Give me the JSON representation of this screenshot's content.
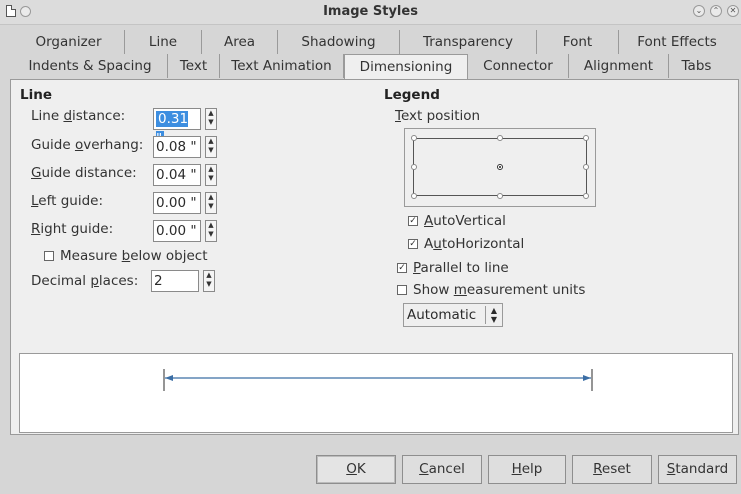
{
  "window": {
    "title": "Image Styles"
  },
  "tabs_row1": [
    "Organizer",
    "Line",
    "Area",
    "Shadowing",
    "Transparency",
    "Font",
    "Font Effects"
  ],
  "tabs_row2": [
    "Indents & Spacing",
    "Text",
    "Text Animation",
    "Dimensioning",
    "Connector",
    "Alignment",
    "Tabs"
  ],
  "active_tab": "Dimensioning",
  "line": {
    "title": "Line",
    "line_distance": {
      "label_pre": "Line ",
      "label_mn": "d",
      "label_post": "istance:",
      "value": "0.31 \""
    },
    "guide_overhang": {
      "label_pre": "Guide ",
      "label_mn": "o",
      "label_post": "verhang:",
      "value": "0.08 \""
    },
    "guide_distance": {
      "label_pre": "",
      "label_mn": "G",
      "label_post": "uide distance:",
      "value": "0.04 \""
    },
    "left_guide": {
      "label_pre": "",
      "label_mn": "L",
      "label_post": "eft guide:",
      "value": "0.00 \""
    },
    "right_guide": {
      "label_pre": "",
      "label_mn": "R",
      "label_post": "ight guide:",
      "value": "0.00 \""
    },
    "measure_below": {
      "label_pre": "Measure ",
      "label_mn": "b",
      "label_post": "elow object",
      "checked": false
    },
    "decimal_places": {
      "label_pre": "Decimal ",
      "label_mn": "p",
      "label_post": "laces:",
      "value": "2"
    }
  },
  "legend": {
    "title": "Legend",
    "text_position": {
      "label_pre": "",
      "label_mn": "T",
      "label_post": "ext position"
    },
    "auto_vertical": {
      "label_pre": "",
      "label_mn": "A",
      "label_post": "utoVertical",
      "checked": true
    },
    "auto_horizontal": {
      "label_pre": "A",
      "label_mn": "u",
      "label_post": "toHorizontal",
      "checked": true
    },
    "parallel": {
      "label_pre": "",
      "label_mn": "P",
      "label_post": "arallel to line",
      "checked": true
    },
    "show_units": {
      "label_pre": "Show ",
      "label_mn": "m",
      "label_post": "easurement units",
      "checked": false
    },
    "units_combo": "Automatic"
  },
  "buttons": {
    "ok": {
      "mn": "O",
      "post": "K"
    },
    "cancel": {
      "mn": "C",
      "post": "ancel"
    },
    "help": {
      "mn": "H",
      "post": "elp"
    },
    "reset": {
      "mn": "R",
      "post": "eset"
    },
    "standard": {
      "mn": "S",
      "post": "tandard"
    }
  },
  "colors": {
    "accent": "#3d8ee0",
    "dimension_line": "#3b6ea5"
  }
}
